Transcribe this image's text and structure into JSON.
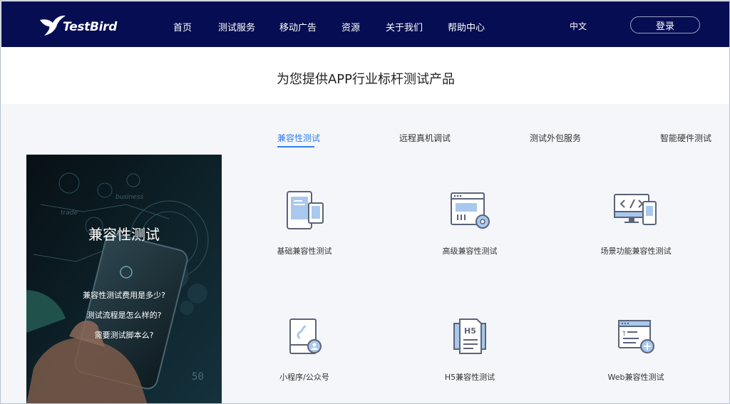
{
  "header": {
    "logo_text": "TestBird",
    "nav": [
      {
        "id": "home",
        "label": "首页"
      },
      {
        "id": "services",
        "label": "测试服务"
      },
      {
        "id": "ads",
        "label": "移动广告"
      },
      {
        "id": "resources",
        "label": "资源"
      },
      {
        "id": "about",
        "label": "关于我们"
      },
      {
        "id": "help",
        "label": "帮助中心"
      }
    ],
    "language": "中文",
    "login_label": "登录"
  },
  "main": {
    "title": "为您提供APP行业标杆测试产品",
    "tabs": [
      {
        "label": "兼容性测试",
        "active": true
      },
      {
        "label": "远程真机调试",
        "active": false
      },
      {
        "label": "测试外包服务",
        "active": false
      },
      {
        "label": "智能硬件测试",
        "active": false
      }
    ],
    "promo": {
      "title": "兼容性测试",
      "questions": [
        "兼容性测试费用是多少?",
        "测试流程是怎么样的?",
        "需要测试脚本么?"
      ]
    },
    "products": [
      {
        "label": "基础兼容性测试",
        "icon": "mobile-tablet-icon"
      },
      {
        "label": "高级兼容性测试",
        "icon": "browser-gear-icon"
      },
      {
        "label": "场景功能兼容性测试",
        "icon": "monitor-code-icon"
      },
      {
        "label": "小程序/公众号",
        "icon": "mini-program-icon"
      },
      {
        "label": "H5兼容性测试",
        "icon": "h5-document-icon"
      },
      {
        "label": "Web兼容性测试",
        "icon": "web-window-icon"
      }
    ]
  },
  "colors": {
    "header_bg": "#060d52",
    "accent": "#2f80ed",
    "content_bg": "#f5f6f9"
  }
}
